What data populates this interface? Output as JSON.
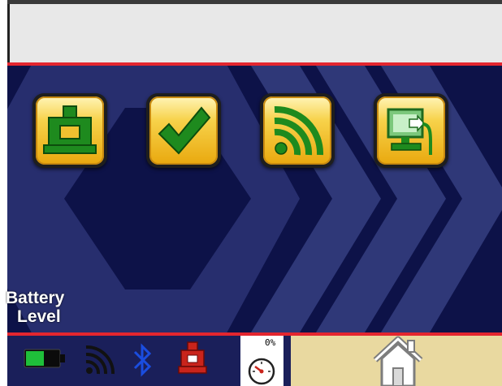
{
  "labels": {
    "battery_line1": "Battery",
    "battery_line2": "Level"
  },
  "status": {
    "percent": "0%"
  },
  "menu": [
    {
      "name": "press-icon"
    },
    {
      "name": "checkmark-icon"
    },
    {
      "name": "wireless-signal-icon"
    },
    {
      "name": "export-to-computer-icon"
    }
  ],
  "colors": {
    "header": "#e8e8e8",
    "background": "#0d1248",
    "accent_red": "#e3262f",
    "button_gold": "#f7d24a",
    "icon_green": "#1e8a1e",
    "home_panel": "#e9d9a0"
  }
}
